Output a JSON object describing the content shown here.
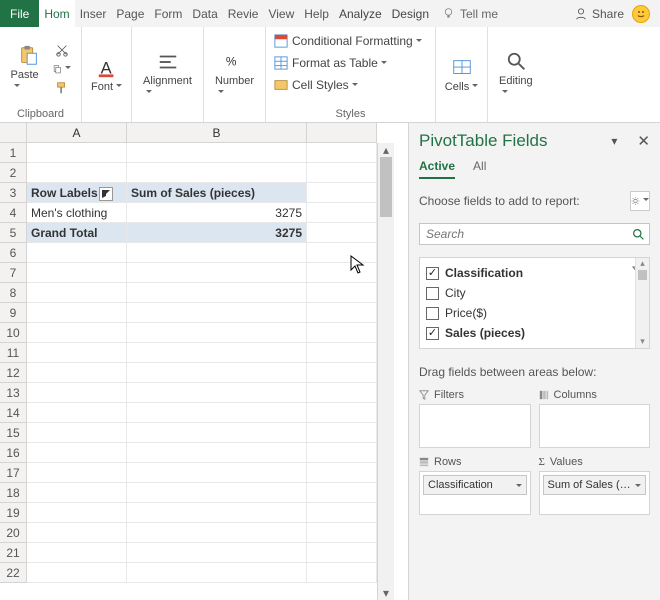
{
  "tabs": {
    "file": "File",
    "home": "Hom",
    "insert": "Inser",
    "page": "Page",
    "formulas": "Form",
    "data": "Data",
    "review": "Revie",
    "view": "View",
    "help": "Help",
    "analyze": "Analyze",
    "design": "Design",
    "tellme": "Tell me",
    "share": "Share"
  },
  "ribbon": {
    "clipboard": {
      "label": "Clipboard",
      "paste": "Paste"
    },
    "font": {
      "label": "Font"
    },
    "alignment": {
      "label": "Alignment"
    },
    "number": {
      "label": "Number"
    },
    "styles": {
      "label": "Styles",
      "cf": "Conditional Formatting",
      "fat": "Format as Table",
      "cs": "Cell Styles"
    },
    "cells": {
      "label": "Cells"
    },
    "editing": {
      "label": "Editing"
    }
  },
  "grid": {
    "cols": [
      "A",
      "B"
    ],
    "rows_count": 22,
    "data": {
      "r3": {
        "a": "Row Labels",
        "b": "Sum of Sales (pieces)"
      },
      "r4": {
        "a": "Men's clothing",
        "b": "3275"
      },
      "r5": {
        "a": "Grand Total",
        "b": "3275"
      }
    }
  },
  "pane": {
    "title": "PivotTable Fields",
    "tabs": {
      "active": "Active",
      "all": "All"
    },
    "choose": "Choose fields to add to report:",
    "search_placeholder": "Search",
    "fields": [
      {
        "name": "Classification",
        "checked": true,
        "filtered": true
      },
      {
        "name": "City",
        "checked": false
      },
      {
        "name": "Price($)",
        "checked": false
      },
      {
        "name": "Sales (pieces)",
        "checked": true
      }
    ],
    "drag": "Drag fields between areas below:",
    "areas": {
      "filters": "Filters",
      "columns": "Columns",
      "rows": "Rows",
      "values": "Values",
      "row_chip": "Classification",
      "value_chip": "Sum of Sales (…"
    }
  }
}
